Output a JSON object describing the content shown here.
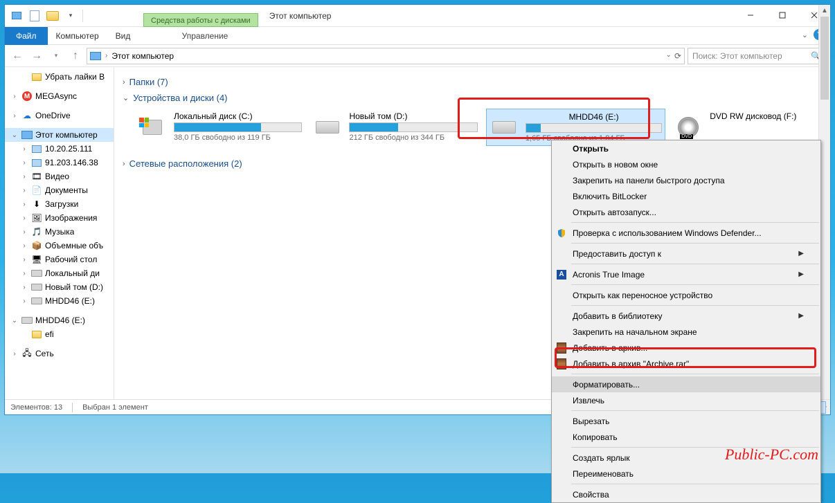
{
  "title": "Этот компьютер",
  "ribbon": {
    "file": "Файл",
    "computer": "Компьютер",
    "view": "Вид",
    "drive_tools": "Средства работы с дисками",
    "manage": "Управление"
  },
  "address": {
    "location": "Этот компьютер",
    "search_placeholder": "Поиск: Этот компьютер"
  },
  "nav": {
    "likes": "Убрать лайки В",
    "mega": "MEGAsync",
    "onedrive": "OneDrive",
    "thispc": "Этот компьютер",
    "net1": "10.20.25.111",
    "net2": "91.203.146.38",
    "video": "Видео",
    "docs": "Документы",
    "downloads": "Загрузки",
    "images": "Изображения",
    "music": "Музыка",
    "volobj": "Объемные объ",
    "desktop": "Рабочий стол",
    "localc": "Локальный ди",
    "newvol": "Новый том (D:)",
    "mhdd": "MHDD46 (E:)",
    "mhdd2": "MHDD46 (E:)",
    "efi": "efi",
    "network": "Сеть"
  },
  "sections": {
    "folders": "Папки (7)",
    "devices": "Устройства и диски (4)",
    "netloc": "Сетевые расположения (2)"
  },
  "drives": {
    "c": {
      "name": "Локальный диск (C:)",
      "stat": "38,0 ГБ свободно из 119 ГБ",
      "fill": 68
    },
    "d": {
      "name": "Новый том (D:)",
      "stat": "212 ГБ свободно из 344 ГБ",
      "fill": 38
    },
    "e": {
      "name": "MHDD46 (E:)",
      "stat": "1,65 ГБ свободно из 1,84 ГБ",
      "fill": 11
    },
    "f": {
      "name": "DVD RW дисковод (F:)"
    }
  },
  "ctx": {
    "open": "Открыть",
    "open_new": "Открыть в новом окне",
    "pin_qa": "Закрепить на панели быстрого доступа",
    "bitlocker": "Включить BitLocker",
    "autorun": "Открыть автозапуск...",
    "defender": "Проверка с использованием Windows Defender...",
    "share": "Предоставить доступ к",
    "acronis": "Acronis True Image",
    "portable": "Открыть как переносное устройство",
    "library": "Добавить в библиотеку",
    "pin_start": "Закрепить на начальном экране",
    "archive": "Добавить в архив...",
    "archive_rar": "Добавить в архив \"Archive.rar\"",
    "format": "Форматировать...",
    "eject": "Извлечь",
    "cut": "Вырезать",
    "copy": "Копировать",
    "shortcut": "Создать ярлык",
    "rename": "Переименовать",
    "properties": "Свойства"
  },
  "status": {
    "elements": "Элементов: 13",
    "selected": "Выбран 1 элемент"
  },
  "watermark": "Public-PC.com"
}
